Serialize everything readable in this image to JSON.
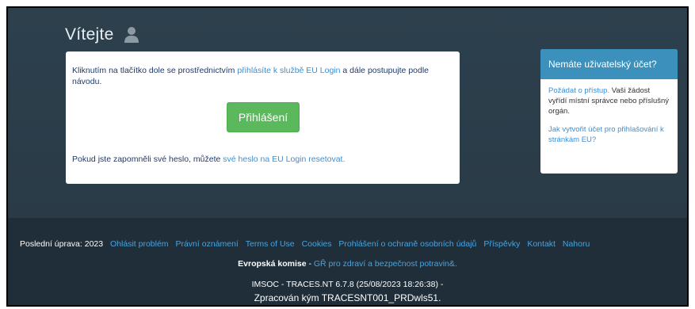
{
  "welcome": {
    "title": "Vítejte"
  },
  "login": {
    "text1_before": "Kliknutím na tlačítko dole se prostřednictvím ",
    "text1_link": "přihlásíte k službě EU Login",
    "text1_after": " a dále postupujte podle návodu.",
    "button_label": "Přihlášení",
    "text2_before": "Pokud jste zapomněli své heslo, můžete ",
    "text2_link": "své heslo na EU Login resetovat."
  },
  "sidebar": {
    "heading": "Nemáte uživatelský účet?",
    "request_link": "Požádat o přístup.",
    "request_text": " Vaši žádost vyřídí místní správce nebo příslušný orgán.",
    "howto_link": "Jak vytvořit účet pro přihlašování k stránkám EU?"
  },
  "footer": {
    "updated_label": "Poslední úprava:",
    "updated_year": "2023",
    "links": [
      "Ohlásit problém",
      "Právní oznámení",
      "Terms of Use",
      "Cookies",
      "Prohlášení o ochraně osobních údajů",
      "Příspěvky",
      "Kontakt",
      "Nahoru"
    ],
    "ec_label": "Evropská komise",
    "ec_sep": " - ",
    "dg_link": "GŘ pro zdraví a bezpečnost potravin&.",
    "version": "IMSOC - TRACES.NT 6.7.8 (25/08/2023 18:26:38) -",
    "processed": "Zpracován kým TRACESNT001_PRDwls51."
  },
  "colors": {
    "background": "#2c3e4a",
    "footer": "#1f2e38",
    "button": "#5cb85c",
    "sidebar_head": "#3b91bc",
    "link": "#3b8fd6"
  },
  "icons": {
    "user": "user-icon"
  }
}
